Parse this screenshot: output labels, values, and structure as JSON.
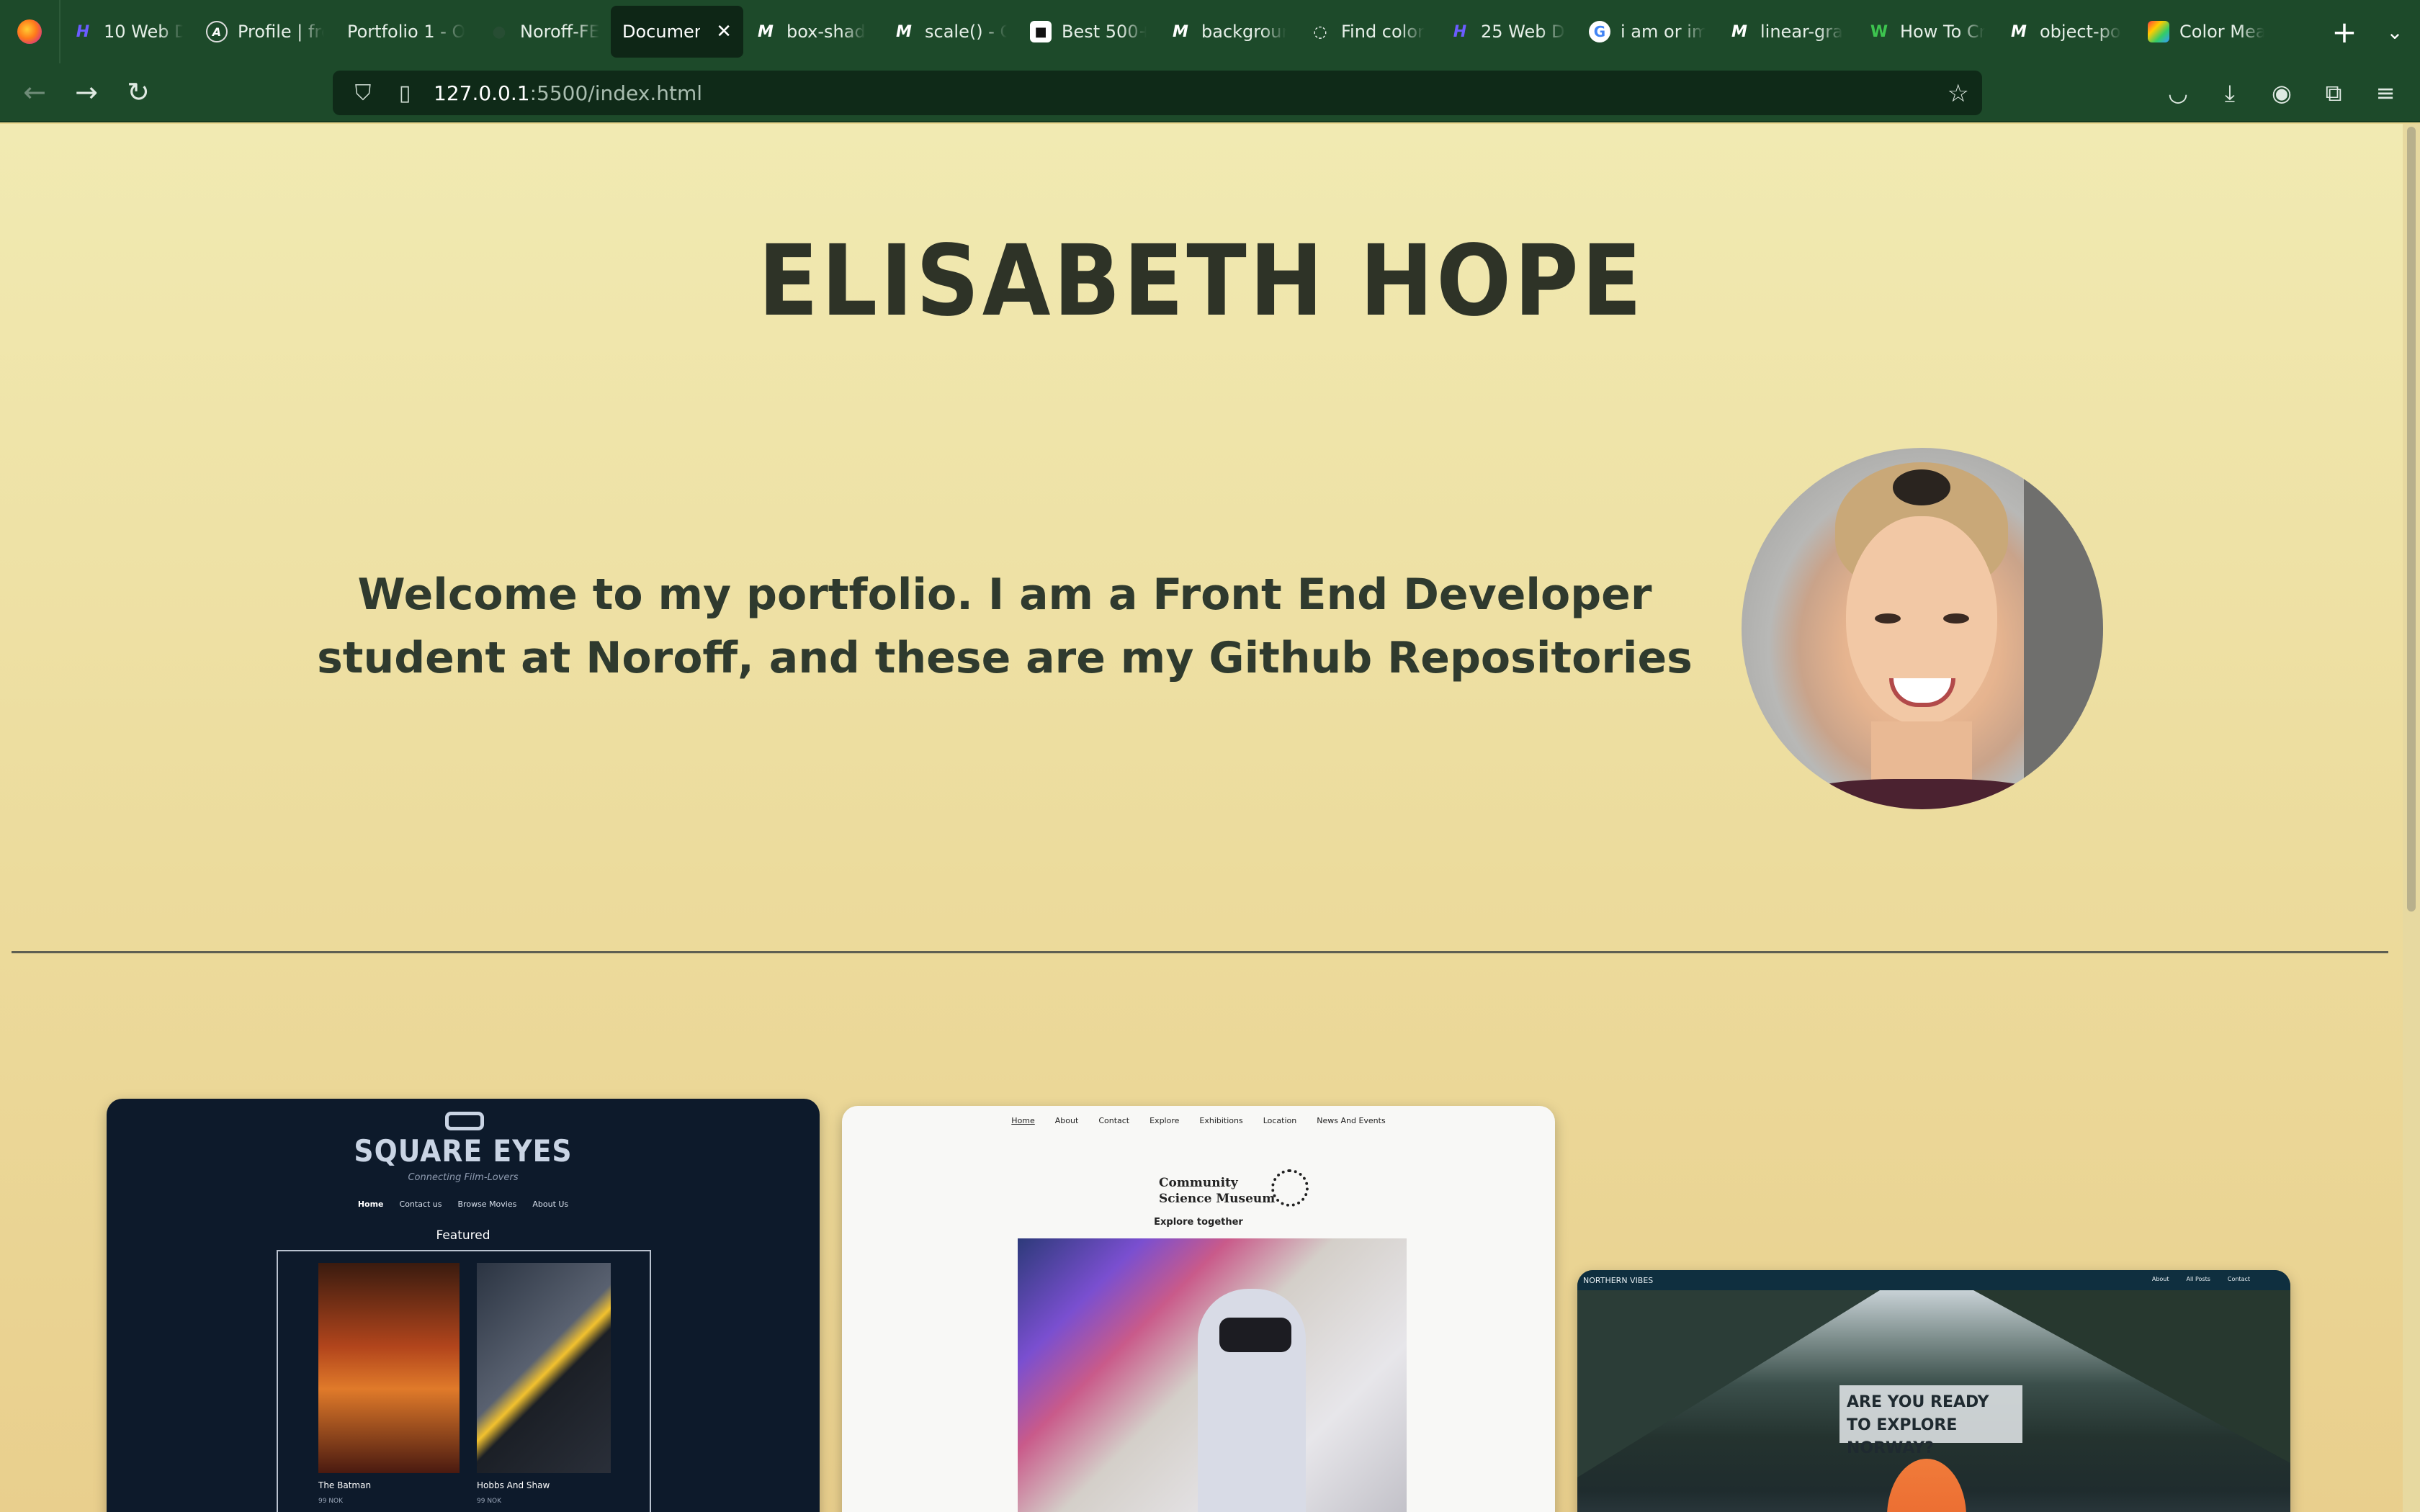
{
  "browser": {
    "tabs": [
      {
        "label": "10 Web De",
        "icon": "M",
        "icon_color": "#6b5cff"
      },
      {
        "label": "Profile | fre",
        "icon": "A",
        "icon_color": "#1d1d1d"
      },
      {
        "label": "Portfolio 1 - O",
        "icon": "",
        "icon_color": "#1d4a2a"
      },
      {
        "label": "Noroff-FE",
        "icon": "",
        "icon_color": "#1d4a2a"
      },
      {
        "label": "Document",
        "icon": "",
        "icon_color": "#0e2616"
      },
      {
        "label": "box-shad",
        "icon": "M",
        "icon_color": "#1d1d1d"
      },
      {
        "label": "scale() - C",
        "icon": "M",
        "icon_color": "#1d1d1d"
      },
      {
        "label": "Best 500+",
        "icon": "u",
        "icon_color": "#111111"
      },
      {
        "label": "backgroun",
        "icon": "M",
        "icon_color": "#1d1d1d"
      },
      {
        "label": "Find color",
        "icon": "o",
        "icon_color": "#1d1d1d"
      },
      {
        "label": "25 Web De",
        "icon": "H",
        "icon_color": "#6b5cff"
      },
      {
        "label": "i am or im",
        "icon": "G",
        "icon_color": "#ffffff"
      },
      {
        "label": "linear-gra",
        "icon": "M",
        "icon_color": "#1d1d1d"
      },
      {
        "label": "How To Cr",
        "icon": "W",
        "icon_color": "#2aa43a"
      },
      {
        "label": "object-po",
        "icon": "M",
        "icon_color": "#1d1d1d"
      },
      {
        "label": "Color Mea",
        "icon": "■",
        "icon_color": "#ffb400"
      }
    ],
    "active_tab_close": "✕",
    "url_host": "127.0.0.1",
    "url_rest": ":5500/index.html"
  },
  "page": {
    "name": "ELISABETH HOPE",
    "intro": "Welcome to my portfolio. I am a Front End Developer student at Noroff, and these are my Github Repositories"
  },
  "projects": {
    "square_eyes": {
      "logo": "SQUARE EYES",
      "tagline": "Connecting Film-Lovers",
      "nav": [
        "Home",
        "Contact us",
        "Browse Movies",
        "About Us"
      ],
      "featured": "Featured",
      "movies": [
        {
          "title": "The Batman",
          "price": "99 NOK"
        },
        {
          "title": "Hobbs And Shaw",
          "price": "99 NOK"
        }
      ]
    },
    "museum": {
      "nav": [
        "Home",
        "About",
        "Contact",
        "Explore",
        "Exhibitions",
        "Location",
        "News And Events"
      ],
      "logo_line1": "Community",
      "logo_line2": "Science Museum",
      "tagline": "Explore together"
    },
    "northern_vibes": {
      "brand": "NORTHERN VIBES",
      "nav": [
        "About",
        "All Posts",
        "Contact"
      ],
      "cta": "ARE YOU READY TO EXPLORE NORWAY?"
    }
  }
}
